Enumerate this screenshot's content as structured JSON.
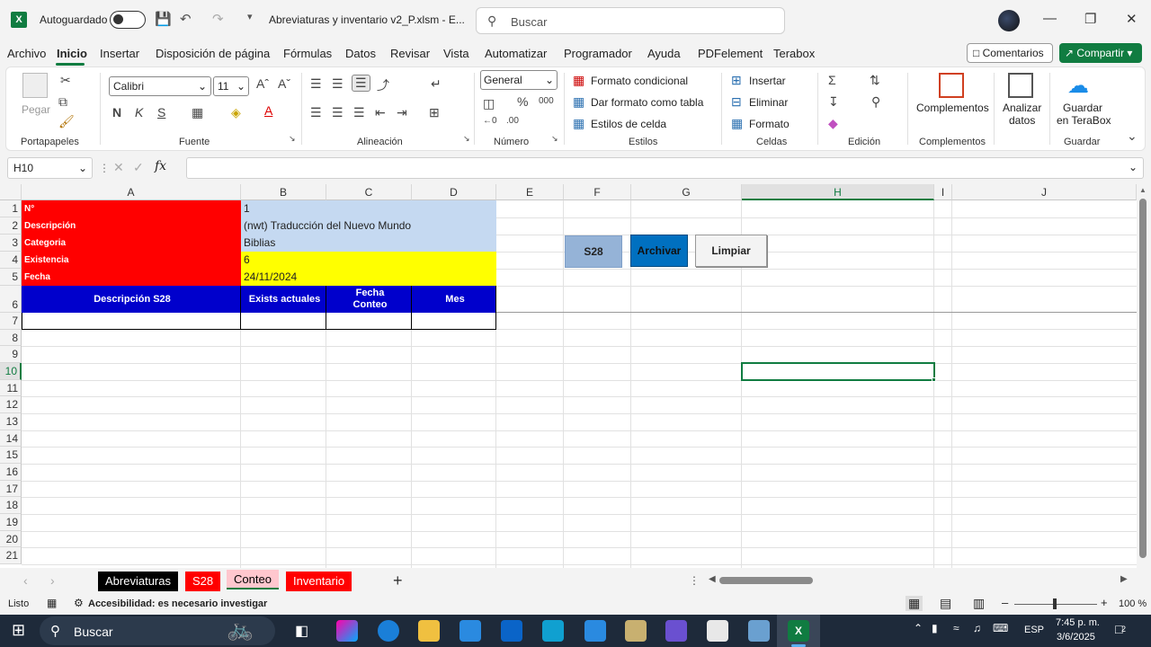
{
  "titlebar": {
    "autosave_label": "Autoguardado",
    "doc_title": "Abreviaturas y inventario v2_P.xlsm  -  E...",
    "search_placeholder": "Buscar"
  },
  "menu": {
    "items": [
      "Archivo",
      "Inicio",
      "Insertar",
      "Disposición de página",
      "Fórmulas",
      "Datos",
      "Revisar",
      "Vista",
      "Automatizar",
      "Programador",
      "Ayuda",
      "PDFelement",
      "Terabox"
    ],
    "comentarios": "Comentarios",
    "compartir": "Compartir"
  },
  "ribbon": {
    "pegar": "Pegar",
    "font_name": "Calibri",
    "font_size": "11",
    "number_format": "General",
    "formato_condicional": "Formato condicional",
    "dar_formato": "Dar formato como tabla",
    "estilos_celda": "Estilos de celda",
    "insertar": "Insertar",
    "eliminar": "Eliminar",
    "formato": "Formato",
    "complementos": "Complementos",
    "analizar": "Analizar",
    "datos": "datos",
    "guardar": "Guardar",
    "en_terabox": "en TeraBox",
    "groups": {
      "portapapeles": "Portapapeles",
      "fuente": "Fuente",
      "alineacion": "Alineación",
      "numero": "Número",
      "estilos": "Estilos",
      "celdas": "Celdas",
      "edicion": "Edición",
      "complementos": "Complementos",
      "guardar": "Guardar"
    }
  },
  "formula_bar": {
    "name_box": "H10",
    "fx": "fx",
    "formula": ""
  },
  "grid": {
    "columns": [
      "A",
      "B",
      "C",
      "D",
      "E",
      "F",
      "G",
      "H",
      "I",
      "J"
    ],
    "rows": [
      "1",
      "2",
      "3",
      "4",
      "5",
      "6",
      "7",
      "8",
      "9",
      "10",
      "11",
      "12",
      "13",
      "14",
      "15",
      "16",
      "17",
      "18",
      "19",
      "20",
      "21"
    ],
    "labels": {
      "n": "N°",
      "descripcion": "Descripción",
      "categoria": "Categoria",
      "existencia": "Existencia",
      "fecha": "Fecha"
    },
    "values": {
      "n": "1",
      "descripcion": "(nwt) Traducción del Nuevo Mundo",
      "categoria": "Biblias",
      "existencia": "6",
      "fecha": "24/11/2024"
    },
    "table_headers": {
      "desc_s28": "Descripción S28",
      "exists": "Exists actuales",
      "fecha_l1": "Fecha",
      "fecha_l2": "Conteo",
      "mes": "Mes"
    },
    "buttons": {
      "s28": "S28",
      "archivar": "Archivar",
      "limpiar": "Limpiar"
    }
  },
  "sheet_tabs": [
    {
      "label": "Abreviaturas",
      "bg": "#000000",
      "fg": "#ffffff"
    },
    {
      "label": "S28",
      "bg": "#ff0000",
      "fg": "#ffffff"
    },
    {
      "label": "Conteo",
      "bg": "#ffc7ce",
      "fg": "#000000"
    },
    {
      "label": "Inventario",
      "bg": "#ff0000",
      "fg": "#ffffff"
    }
  ],
  "status": {
    "listo": "Listo",
    "accesibilidad": "Accesibilidad: es necesario investigar",
    "zoom": "100 %"
  },
  "taskbar": {
    "search": "Buscar",
    "lang": "ESP",
    "time": "7:45 p. m.",
    "date": "3/6/2025",
    "notif_count": "2"
  },
  "colors": {
    "accent": "#107c41",
    "red": "#ff0000",
    "header_blue": "#0000cc",
    "light_blue": "#c5d9f1",
    "yellow": "#ffff00"
  }
}
